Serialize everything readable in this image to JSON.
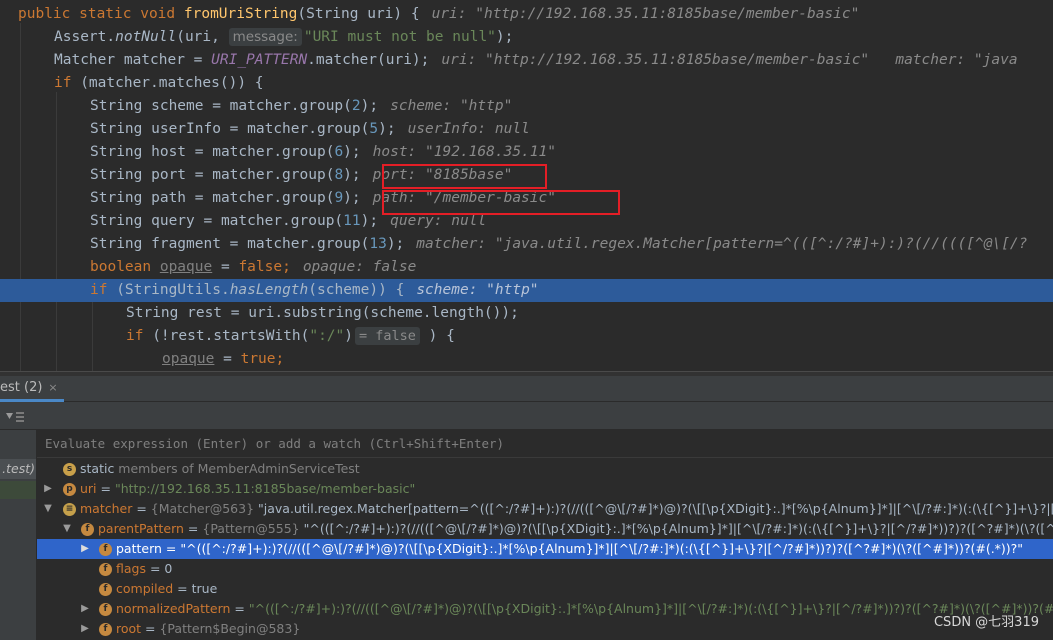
{
  "editor": {
    "line1": {
      "kw": "public static void ",
      "method": "fromUriString",
      "rest": "(String uri) {",
      "hint": "uri: \"http://192.168.35.11:8185base/member-basic\""
    },
    "line2": {
      "pre": "Assert.",
      "call": "notNull",
      "open": "(uri, ",
      "param_name": "message:",
      "str": "\"URI must not be null\"",
      "close": ");"
    },
    "line3": {
      "pre": "Matcher matcher = ",
      "static": "URI_PATTERN",
      "rest": ".matcher(uri);",
      "hint": "uri: \"http://192.168.35.11:8185base/member-basic\"   matcher: \"java"
    },
    "line4": {
      "kw": "if ",
      "rest": "(matcher.matches()) {"
    },
    "line5": {
      "code": "String scheme = matcher.group(",
      "num": "2",
      "close": ");",
      "hint": "scheme: \"http\""
    },
    "line6": {
      "code": "String userInfo = matcher.group(",
      "num": "5",
      "close": ");",
      "hint": "userInfo: null"
    },
    "line7": {
      "code": "String host = matcher.group(",
      "num": "6",
      "close": ");",
      "hint": "host: \"192.168.35.11\""
    },
    "line8": {
      "code": "String port = matcher.group(",
      "num": "8",
      "close": ");",
      "hint": "port: \"8185base\""
    },
    "line9": {
      "code": "String path = matcher.group(",
      "num": "9",
      "close": ");",
      "hint": "path: \"/member-basic\""
    },
    "line10": {
      "code": "String query = matcher.group(",
      "num": "11",
      "close": ");",
      "hint": "query: null"
    },
    "line11": {
      "code": "String fragment = matcher.group(",
      "num": "13",
      "close": ");",
      "hint": "matcher: \"java.util.regex.Matcher[pattern=^(([^:/?#]+):)?(//((([^@\\[/?"
    },
    "line12": {
      "kw": "boolean ",
      "var": "opaque",
      "mid": " = ",
      "kw2": "false",
      "end": ";",
      "hint": "opaque: false"
    },
    "line13": {
      "kw": "if ",
      "pre": "(StringUtils.",
      "call": "hasLength",
      "rest": "(scheme)) {",
      "hint": "scheme: \"http\""
    },
    "line14": {
      "code": "String rest = uri.substring(scheme.length());"
    },
    "line15": {
      "kw": "if ",
      "pre": "(!rest.startsWith(",
      "str": "\":/\"",
      "close": ")",
      "value_hint": "= false",
      "end": " ) {"
    },
    "line16": {
      "var": "opaque",
      "mid": " = ",
      "kw": "true",
      "end": ";"
    }
  },
  "debug": {
    "tab_label": "est (2)",
    "tab_close": "×",
    "watch_placeholder": "Evaluate expression (Enter) or add a watch (Ctrl+Shift+Enter)",
    "frames": [
      ".test)"
    ],
    "variables": [
      {
        "name": "static",
        "rest": " members of MemberAdminServiceTest",
        "icon": "s"
      },
      {
        "name": "uri",
        "sep": " = ",
        "value": "\"http://192.168.35.11:8185base/member-basic\"",
        "icon": "p"
      },
      {
        "name": "matcher",
        "sep": " = ",
        "type": "{Matcher@563}",
        "value": " \"java.util.regex.Matcher[pattern=^(([^:/?#]+):)?(//(([^@\\[/?#]*)@)?(\\[[\\p{XDigit}:.]*[%\\p{Alnum}]*]|[^\\[/?#:]*)(:(\\{[^}]+\\}?|[^/?#]*))?)?([^?#]*)(\\?([^#]*))?(#(.*))?\"",
        "icon": "f"
      },
      {
        "name": "parentPattern",
        "sep": " = ",
        "type": "{Pattern@555}",
        "value": " \"^(([^:/?#]+):)?(//(([^@\\[/?#]*)@)?(\\[[\\p{XDigit}:.]*[%\\p{Alnum}]*]|[^\\[/?#:]*)(:(\\{[^}]+\\}?|[^/?#]*))?)?([^?#]*)(\\?([^#]*))?(#(.*))?\"",
        "icon": "f"
      },
      {
        "name": "pattern",
        "sep": " = ",
        "value": "\"^(([^:/?#]+):)?(//(([^@\\[/?#]*)@)?(\\[[\\p{XDigit}:.]*[%\\p{Alnum}]*]|[^\\[/?#:]*)(:(\\{[^}]+\\}?|[^/?#]*))?)?([^?#]*)(\\?([^#]*))?(#(.*))?\"",
        "icon": "f"
      },
      {
        "name": "flags",
        "sep": " = ",
        "value": "0",
        "icon": "f"
      },
      {
        "name": "compiled",
        "sep": " = ",
        "value": "true",
        "icon": "f"
      },
      {
        "name": "normalizedPattern",
        "sep": " = ",
        "value": "\"^(([^:/?#]+):)?(//(([^@\\[/?#]*)@)?(\\[[\\p{XDigit}:.]*[%\\p{Alnum}]*]|[^\\[/?#:]*)(:(\\{[^}]+\\}?|[^/?#]*))?)?([^?#]*)(\\?([^#]*))?(#(.*))?\"",
        "icon": "f"
      },
      {
        "name": "root",
        "sep": " = ",
        "type": "{Pattern$Begin@583}",
        "icon": "f"
      }
    ]
  },
  "watermark": "CSDN @七羽319",
  "colors": {
    "accent": "#2f65ca",
    "execution_line": "#2d5b9a",
    "highlight_box": "#e41e26"
  }
}
